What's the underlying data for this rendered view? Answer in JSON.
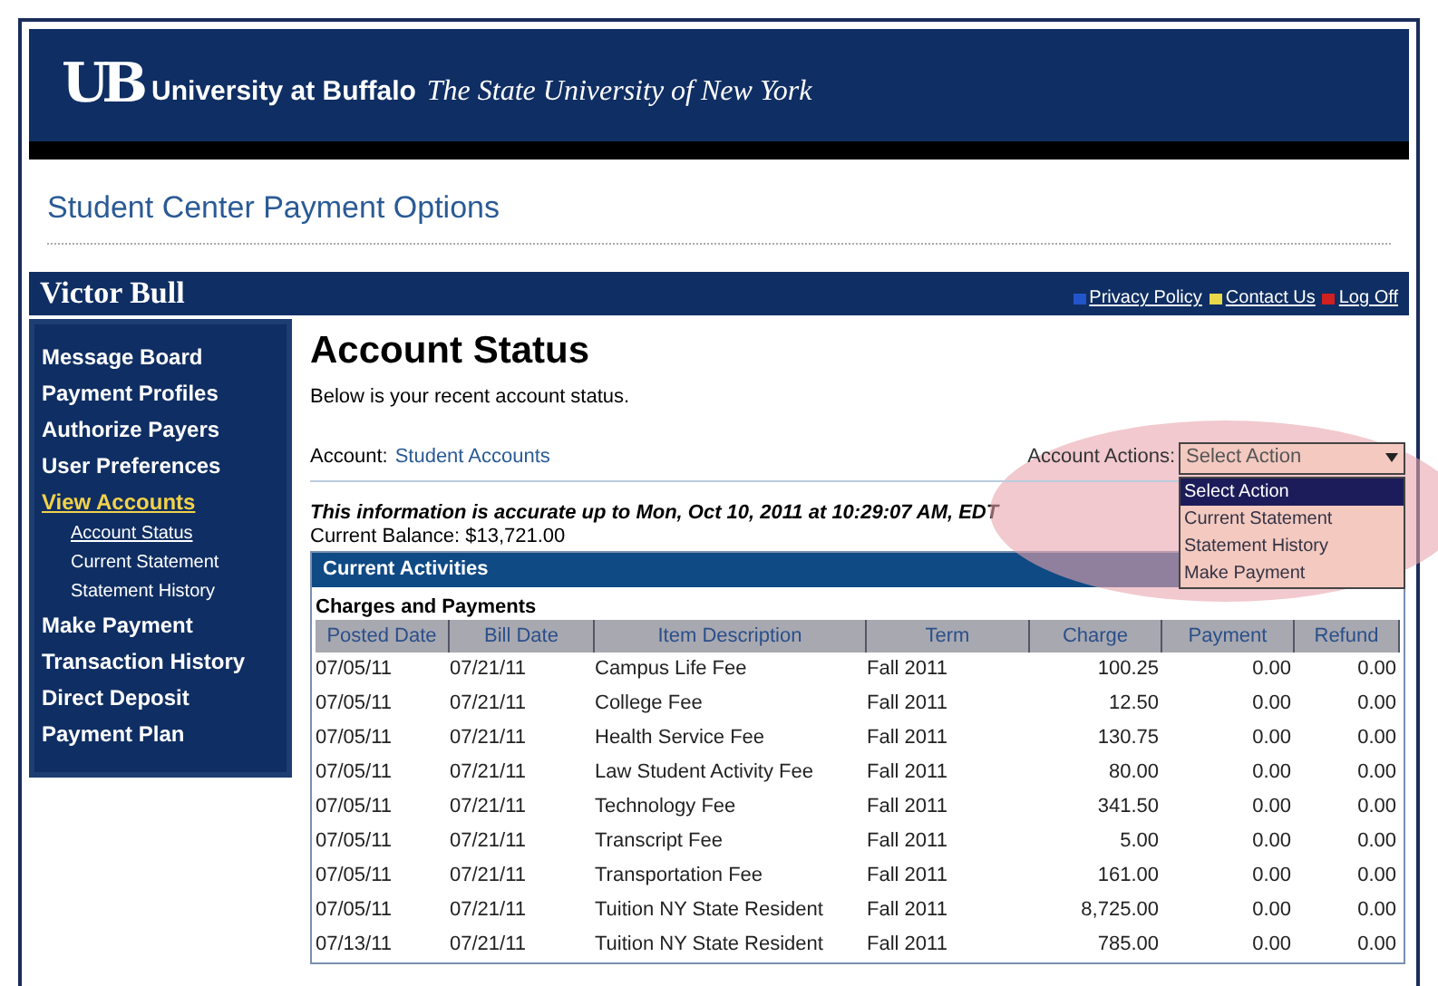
{
  "header": {
    "logo": "UB",
    "university": "University at Buffalo",
    "tagline": "The State University of New York"
  },
  "page_title": "Student Center Payment Options",
  "user_bar": {
    "name": "Victor Bull",
    "links": [
      {
        "label": "Privacy Policy",
        "kind": "info"
      },
      {
        "label": "Contact Us",
        "kind": "mail"
      },
      {
        "label": "Log Off",
        "kind": "close"
      }
    ]
  },
  "sidebar": {
    "items": [
      {
        "label": "Message Board",
        "selected": false
      },
      {
        "label": "Payment Profiles",
        "selected": false
      },
      {
        "label": "Authorize Payers",
        "selected": false
      },
      {
        "label": "User Preferences",
        "selected": false
      },
      {
        "label": "View Accounts",
        "selected": true,
        "children": [
          {
            "label": "Account Status",
            "selected": true
          },
          {
            "label": "Current Statement",
            "selected": false
          },
          {
            "label": "Statement History",
            "selected": false
          }
        ]
      },
      {
        "label": "Make Payment",
        "selected": false
      },
      {
        "label": "Transaction History",
        "selected": false
      },
      {
        "label": "Direct Deposit",
        "selected": false
      },
      {
        "label": "Payment Plan",
        "selected": false
      }
    ]
  },
  "content": {
    "title": "Account Status",
    "description": "Below is your recent account status.",
    "account_label": "Account:",
    "account_value": "Student Accounts",
    "actions_label": "Account Actions:",
    "actions_select": {
      "value": "Select Action",
      "expanded": true,
      "options": [
        {
          "label": "Select Action",
          "selected": true
        },
        {
          "label": "Current Statement",
          "selected": false
        },
        {
          "label": "Statement History",
          "selected": false
        },
        {
          "label": "Make Payment",
          "selected": false
        }
      ]
    },
    "accuracy_note": "This information is accurate up to Mon, Oct 10, 2011 at 10:29:07 AM, EDT",
    "balance": "Current Balance: $13,721.00"
  },
  "table": {
    "title": "Current Activities",
    "subtitle": "Charges and Payments",
    "columns": [
      "Posted Date",
      "Bill Date",
      "Item Description",
      "Term",
      "Charge",
      "Payment",
      "Refund"
    ],
    "rows": [
      [
        "07/05/11",
        "07/21/11",
        "Campus Life Fee",
        "Fall 2011",
        "100.25",
        "0.00",
        "0.00"
      ],
      [
        "07/05/11",
        "07/21/11",
        "College Fee",
        "Fall 2011",
        "12.50",
        "0.00",
        "0.00"
      ],
      [
        "07/05/11",
        "07/21/11",
        "Health Service Fee",
        "Fall 2011",
        "130.75",
        "0.00",
        "0.00"
      ],
      [
        "07/05/11",
        "07/21/11",
        "Law Student Activity Fee",
        "Fall 2011",
        "80.00",
        "0.00",
        "0.00"
      ],
      [
        "07/05/11",
        "07/21/11",
        "Technology Fee",
        "Fall 2011",
        "341.50",
        "0.00",
        "0.00"
      ],
      [
        "07/05/11",
        "07/21/11",
        "Transcript Fee",
        "Fall 2011",
        "5.00",
        "0.00",
        "0.00"
      ],
      [
        "07/05/11",
        "07/21/11",
        "Transportation Fee",
        "Fall 2011",
        "161.00",
        "0.00",
        "0.00"
      ],
      [
        "07/05/11",
        "07/21/11",
        "Tuition NY State Resident",
        "Fall 2011",
        "8,725.00",
        "0.00",
        "0.00"
      ],
      [
        "07/13/11",
        "07/21/11",
        "Tuition NY State Resident",
        "Fall 2011",
        "785.00",
        "0.00",
        "0.00"
      ]
    ]
  }
}
